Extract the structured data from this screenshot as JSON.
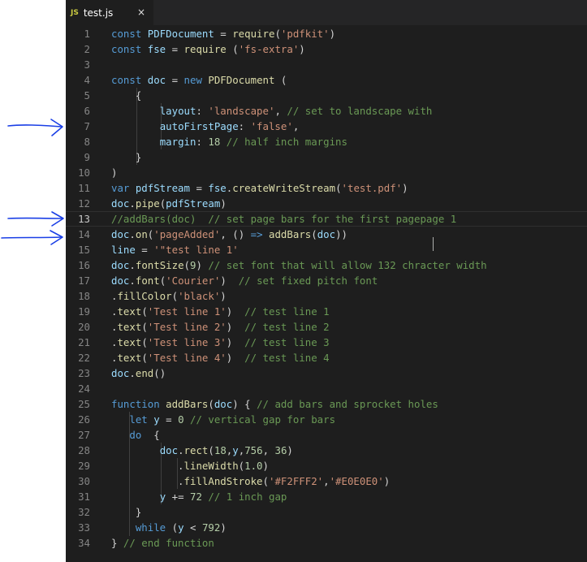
{
  "tab": {
    "icon": "js-file-icon",
    "badge": "JS",
    "label": "test.js",
    "close": "×"
  },
  "colors": {
    "keyword": "#569cd6",
    "function": "#dcdcaa",
    "string": "#ce9178",
    "comment": "#6a9955",
    "variable": "#9cdcfe",
    "number": "#b5cea8",
    "plain": "#d4d4d4",
    "annotation_arrow": "#1a3fe6"
  },
  "current_line": 13,
  "lines": [
    {
      "n": "1",
      "t": [
        [
          "kw",
          "const "
        ],
        [
          "var",
          "PDFDocument"
        ],
        [
          "p",
          " = "
        ],
        [
          "fn",
          "require"
        ],
        [
          "p",
          "("
        ],
        [
          "str",
          "'pdfkit'"
        ],
        [
          "p",
          ")"
        ]
      ]
    },
    {
      "n": "2",
      "t": [
        [
          "kw",
          "const "
        ],
        [
          "var",
          "fse"
        ],
        [
          "p",
          " = "
        ],
        [
          "fn",
          "require"
        ],
        [
          "p",
          " ("
        ],
        [
          "str",
          "'fs-extra'"
        ],
        [
          "p",
          ")"
        ]
      ]
    },
    {
      "n": "3",
      "t": []
    },
    {
      "n": "4",
      "t": [
        [
          "kw",
          "const "
        ],
        [
          "var",
          "doc"
        ],
        [
          "p",
          " = "
        ],
        [
          "kw",
          "new "
        ],
        [
          "fn",
          "PDFDocument"
        ],
        [
          "p",
          " ("
        ]
      ]
    },
    {
      "n": "5",
      "t": [
        [
          "p",
          "    {"
        ]
      ]
    },
    {
      "n": "6",
      "t": [
        [
          "p",
          "        "
        ],
        [
          "var",
          "layout"
        ],
        [
          "p",
          ": "
        ],
        [
          "str",
          "'landscape'"
        ],
        [
          "p",
          ", "
        ],
        [
          "cm",
          "// set to landscape with"
        ]
      ]
    },
    {
      "n": "7",
      "t": [
        [
          "p",
          "        "
        ],
        [
          "var",
          "autoFirstPage"
        ],
        [
          "p",
          ": "
        ],
        [
          "str",
          "'false'"
        ],
        [
          "p",
          ","
        ]
      ]
    },
    {
      "n": "8",
      "t": [
        [
          "p",
          "        "
        ],
        [
          "var",
          "margin"
        ],
        [
          "p",
          ": "
        ],
        [
          "num",
          "18"
        ],
        [
          "p",
          " "
        ],
        [
          "cm",
          "// half inch margins"
        ]
      ]
    },
    {
      "n": "9",
      "t": [
        [
          "p",
          "    }"
        ]
      ]
    },
    {
      "n": "10",
      "t": [
        [
          "p",
          ")"
        ]
      ]
    },
    {
      "n": "11",
      "t": [
        [
          "kw",
          "var "
        ],
        [
          "var",
          "pdfStream"
        ],
        [
          "p",
          " = "
        ],
        [
          "var",
          "fse"
        ],
        [
          "p",
          "."
        ],
        [
          "fn",
          "createWriteStream"
        ],
        [
          "p",
          "("
        ],
        [
          "str",
          "'test.pdf'"
        ],
        [
          "p",
          ")"
        ]
      ]
    },
    {
      "n": "12",
      "t": [
        [
          "var",
          "doc"
        ],
        [
          "p",
          "."
        ],
        [
          "fn",
          "pipe"
        ],
        [
          "p",
          "("
        ],
        [
          "var",
          "pdfStream"
        ],
        [
          "p",
          ")"
        ]
      ]
    },
    {
      "n": "13",
      "t": [
        [
          "cm",
          "//addBars(doc)  // set page bars for the first pagepage 1"
        ]
      ]
    },
    {
      "n": "14",
      "t": [
        [
          "var",
          "doc"
        ],
        [
          "p",
          "."
        ],
        [
          "fn",
          "on"
        ],
        [
          "p",
          "("
        ],
        [
          "str",
          "'pageAdded'"
        ],
        [
          "p",
          ", () "
        ],
        [
          "kw",
          "=>"
        ],
        [
          "p",
          " "
        ],
        [
          "fn",
          "addBars"
        ],
        [
          "p",
          "("
        ],
        [
          "var",
          "doc"
        ],
        [
          "p",
          "))"
        ]
      ]
    },
    {
      "n": "15",
      "t": [
        [
          "var",
          "line"
        ],
        [
          "p",
          " = "
        ],
        [
          "str",
          "'\"test line 1'"
        ]
      ]
    },
    {
      "n": "16",
      "t": [
        [
          "var",
          "doc"
        ],
        [
          "p",
          "."
        ],
        [
          "fn",
          "fontSize"
        ],
        [
          "p",
          "("
        ],
        [
          "num",
          "9"
        ],
        [
          "p",
          ") "
        ],
        [
          "cm",
          "// set font that will allow 132 chracter width"
        ]
      ]
    },
    {
      "n": "17",
      "t": [
        [
          "var",
          "doc"
        ],
        [
          "p",
          "."
        ],
        [
          "fn",
          "font"
        ],
        [
          "p",
          "("
        ],
        [
          "str",
          "'Courier'"
        ],
        [
          "p",
          ")  "
        ],
        [
          "cm",
          "// set fixed pitch font"
        ]
      ]
    },
    {
      "n": "18",
      "t": [
        [
          "p",
          "."
        ],
        [
          "fn",
          "fillColor"
        ],
        [
          "p",
          "("
        ],
        [
          "str",
          "'black'"
        ],
        [
          "p",
          ")"
        ]
      ]
    },
    {
      "n": "19",
      "t": [
        [
          "p",
          "."
        ],
        [
          "fn",
          "text"
        ],
        [
          "p",
          "("
        ],
        [
          "str",
          "'Test line 1'"
        ],
        [
          "p",
          ")  "
        ],
        [
          "cm",
          "// test line 1"
        ]
      ]
    },
    {
      "n": "20",
      "t": [
        [
          "p",
          "."
        ],
        [
          "fn",
          "text"
        ],
        [
          "p",
          "("
        ],
        [
          "str",
          "'Test line 2'"
        ],
        [
          "p",
          ")  "
        ],
        [
          "cm",
          "// test line 2"
        ]
      ]
    },
    {
      "n": "21",
      "t": [
        [
          "p",
          "."
        ],
        [
          "fn",
          "text"
        ],
        [
          "p",
          "("
        ],
        [
          "str",
          "'Test line 3'"
        ],
        [
          "p",
          ")  "
        ],
        [
          "cm",
          "// test line 3"
        ]
      ]
    },
    {
      "n": "22",
      "t": [
        [
          "p",
          "."
        ],
        [
          "fn",
          "text"
        ],
        [
          "p",
          "("
        ],
        [
          "str",
          "'Test line 4'"
        ],
        [
          "p",
          ")  "
        ],
        [
          "cm",
          "// test line 4"
        ]
      ]
    },
    {
      "n": "23",
      "t": [
        [
          "var",
          "doc"
        ],
        [
          "p",
          "."
        ],
        [
          "fn",
          "end"
        ],
        [
          "p",
          "()"
        ]
      ]
    },
    {
      "n": "24",
      "t": []
    },
    {
      "n": "25",
      "t": [
        [
          "kw",
          "function "
        ],
        [
          "fn",
          "addBars"
        ],
        [
          "p",
          "("
        ],
        [
          "var",
          "doc"
        ],
        [
          "p",
          ") { "
        ],
        [
          "cm",
          "// add bars and sprocket holes"
        ]
      ]
    },
    {
      "n": "26",
      "t": [
        [
          "p",
          "   "
        ],
        [
          "kw",
          "let "
        ],
        [
          "var",
          "y"
        ],
        [
          "p",
          " = "
        ],
        [
          "num",
          "0"
        ],
        [
          "p",
          " "
        ],
        [
          "cm",
          "// vertical gap for bars"
        ]
      ]
    },
    {
      "n": "27",
      "t": [
        [
          "p",
          "   "
        ],
        [
          "kw",
          "do"
        ],
        [
          "p",
          "  {"
        ]
      ]
    },
    {
      "n": "28",
      "t": [
        [
          "p",
          "        "
        ],
        [
          "var",
          "doc"
        ],
        [
          "p",
          "."
        ],
        [
          "fn",
          "rect"
        ],
        [
          "p",
          "("
        ],
        [
          "num",
          "18"
        ],
        [
          "p",
          ","
        ],
        [
          "var",
          "y"
        ],
        [
          "p",
          ","
        ],
        [
          "num",
          "756"
        ],
        [
          "p",
          ", "
        ],
        [
          "num",
          "36"
        ],
        [
          "p",
          ")"
        ]
      ]
    },
    {
      "n": "29",
      "t": [
        [
          "p",
          "           ."
        ],
        [
          "fn",
          "lineWidth"
        ],
        [
          "p",
          "("
        ],
        [
          "num",
          "1.0"
        ],
        [
          "p",
          ")"
        ]
      ]
    },
    {
      "n": "30",
      "t": [
        [
          "p",
          "           ."
        ],
        [
          "fn",
          "fillAndStroke"
        ],
        [
          "p",
          "("
        ],
        [
          "str",
          "'#F2FFF2'"
        ],
        [
          "p",
          ","
        ],
        [
          "str",
          "'#E0E0E0'"
        ],
        [
          "p",
          ")"
        ]
      ]
    },
    {
      "n": "31",
      "t": [
        [
          "p",
          "        "
        ],
        [
          "var",
          "y"
        ],
        [
          "p",
          " += "
        ],
        [
          "num",
          "72"
        ],
        [
          "p",
          " "
        ],
        [
          "cm",
          "// 1 inch gap"
        ]
      ]
    },
    {
      "n": "32",
      "t": [
        [
          "p",
          "    }"
        ]
      ]
    },
    {
      "n": "33",
      "t": [
        [
          "p",
          "    "
        ],
        [
          "kw",
          "while"
        ],
        [
          "p",
          " ("
        ],
        [
          "var",
          "y"
        ],
        [
          "p",
          " < "
        ],
        [
          "num",
          "792"
        ],
        [
          "p",
          ")"
        ]
      ]
    },
    {
      "n": "34",
      "t": [
        [
          "p",
          "} "
        ],
        [
          "cm",
          "// end function"
        ]
      ]
    }
  ],
  "annotations": [
    {
      "icon": "hand-drawn-arrow-icon",
      "points_to_line": "7"
    },
    {
      "icon": "hand-drawn-arrow-icon",
      "points_to_line": "13"
    },
    {
      "icon": "hand-drawn-arrow-icon",
      "points_to_line": "14"
    }
  ]
}
